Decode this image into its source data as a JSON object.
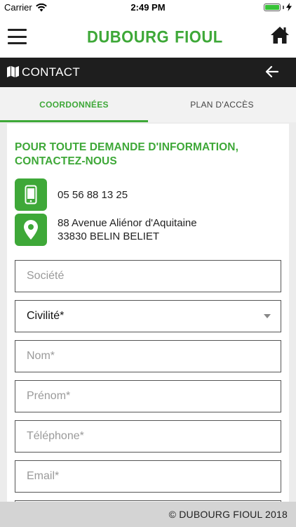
{
  "status_bar": {
    "carrier": "Carrier",
    "time": "2:49 PM",
    "battery_level": 1.0
  },
  "header": {
    "logo_left": "DUBOURG",
    "logo_right": "FIOUL",
    "menu_icon": "hamburger-menu-icon",
    "home_icon": "home-icon"
  },
  "title_bar": {
    "title": "CONTACT",
    "icon": "map-icon",
    "back_icon": "arrow-left-icon"
  },
  "tabs": [
    {
      "label": "COORDONNÉES",
      "active": true
    },
    {
      "label": "PLAN D'ACCÈS",
      "active": false
    }
  ],
  "contact": {
    "intro": "POUR TOUTE DEMANDE D'INFORMATION, CONTACTEZ-NOUS",
    "phone": "05 56 88 13 25",
    "address_line1": "88 Avenue Aliénor d'Aquitaine",
    "address_line2": "33830 BELIN BELIET"
  },
  "form": {
    "societe_placeholder": "Société",
    "civilite_value": "Civilité*",
    "nom_placeholder": "Nom*",
    "prenom_placeholder": "Prénom*",
    "telephone_placeholder": "Téléphone*",
    "email_placeholder": "Email*"
  },
  "footer": {
    "copyright": "© DUBOURG FIOUL 2018"
  },
  "colors": {
    "brand_green": "#3ea838",
    "title_bar_bg": "#1e1e1e",
    "footer_bg": "#d4d4d4"
  }
}
